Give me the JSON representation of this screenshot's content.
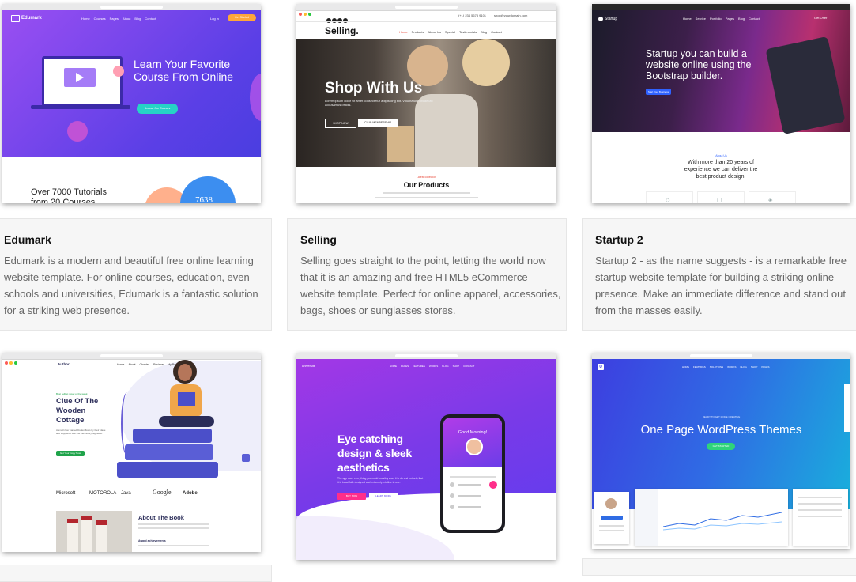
{
  "cards": [
    {
      "title": "Edumark",
      "description": "Edumark is a modern and beautiful free online learning website template. For online courses, education, even schools and universities, Edumark is a fantastic solution for a striking web presence.",
      "preview": {
        "logo": "Edumark",
        "nav": [
          "Home",
          "Courses",
          "Pages",
          "About",
          "Blog",
          "Contact"
        ],
        "login": "Log in",
        "cta": "Get Started",
        "headline": "Learn Your Favorite Course From Online",
        "hero_button": "Browse Our Courses",
        "tutorials": "Over 7000 Tutorials from 20 Courses",
        "stat": "7638",
        "colors": {
          "from": "#8a4bf0",
          "to": "#4f3ee6",
          "accent": "#ffa63a",
          "button": "#26d3c6"
        }
      }
    },
    {
      "title": "Selling",
      "description": "Selling goes straight to the point, letting the world now that it is an amazing and free HTML5 eCommerce website template. Perfect for online apparel, accessories, bags, shoes or sunglasses stores.",
      "preview": {
        "logo": "Selling.",
        "phone": "(+1) 234 5678 9101",
        "email": "shop@yourdomain.com",
        "nav": [
          "Home",
          "Products",
          "About Us",
          "Special",
          "Testimonials",
          "Blog",
          "Contact"
        ],
        "headline": "Shop With Us",
        "subtext": "Lorem ipsum dolor sit amet consectetur adipisicing elit. Voluptatum obcaecati accusamus officiis.",
        "btn_shop": "SHOP NOW",
        "btn_club": "CLUB MEMBERSHIP",
        "section_kicker": "Latest collection",
        "section_title": "Our Products",
        "colors": {
          "active": "#e84c3d"
        }
      }
    },
    {
      "title": "Startup 2",
      "description": "Startup 2 - as the name suggests - is a remarkable free startup website template for building a striking online presence. Make an immediate difference and stand out from the masses easily.",
      "preview": {
        "logo": "Startup",
        "nav": [
          "Home",
          "Service",
          "Portfolio",
          "Pages",
          "Blog",
          "Contact"
        ],
        "cta": "Get Offer",
        "headline": "Startup you can build a website online using the Bootstrap builder.",
        "hero_button": "Start Your Business",
        "tag": "About Us",
        "subtitle": "With more than 20 years of experience we can deliver the best product design.",
        "colors": {
          "button": "#2f62ff"
        }
      }
    },
    {
      "title": "",
      "description": "",
      "preview": {
        "logo": "Author",
        "nav": [
          "Home",
          "About",
          "Chapter",
          "Reviews",
          "My Books"
        ],
        "kicker": "Best selling novel of the week",
        "headline": "Clue Of The Wooden Cottage",
        "blurb": "A small river named Duden flows by their place and supplies it with the necessary regelialia.",
        "button": "Get Your Copy Now",
        "brands": [
          "Microsoft",
          "MOTOROLA",
          "Java",
          "Google",
          "Adobe"
        ],
        "about_title": "About The Book",
        "about_sub": "Award achievements",
        "colors": {
          "accent": "#1fa34a",
          "ink": "#2b2d59",
          "books": "#4b4fc9"
        }
      }
    },
    {
      "title": "",
      "description": "",
      "preview": {
        "logo": "universite",
        "nav": [
          "HOME",
          "PAGES",
          "FEATURES",
          "WORKS",
          "BLOG",
          "SHOP",
          "CONTACT"
        ],
        "headline": "Eye catching design & sleek aesthetics",
        "blurb": "The app does everything you could possibly want it to do and not only that it is beautifully designed and extremely intuitive to use.",
        "btn_buy": "BUY NOW",
        "btn_learn": "LEARN MORE",
        "phone_greeting": "Good Morning!",
        "colors": {
          "from": "#9b33e8",
          "to": "#5a3df0",
          "pink": "#ff2e8a"
        }
      }
    },
    {
      "title": "",
      "description": "",
      "preview": {
        "logo": "U",
        "nav": [
          "HOME",
          "FEATURES",
          "SOLUTIONS",
          "WORKS",
          "BLOG",
          "SHOP",
          "PAGES"
        ],
        "kicker": "READY TO GET MORE CREATIVE",
        "headline": "One Page WordPress Themes",
        "button": "GET STARTED",
        "colors": {
          "from": "#3a4fe0",
          "to": "#17b4dc",
          "button": "#2fd37a"
        }
      }
    }
  ]
}
